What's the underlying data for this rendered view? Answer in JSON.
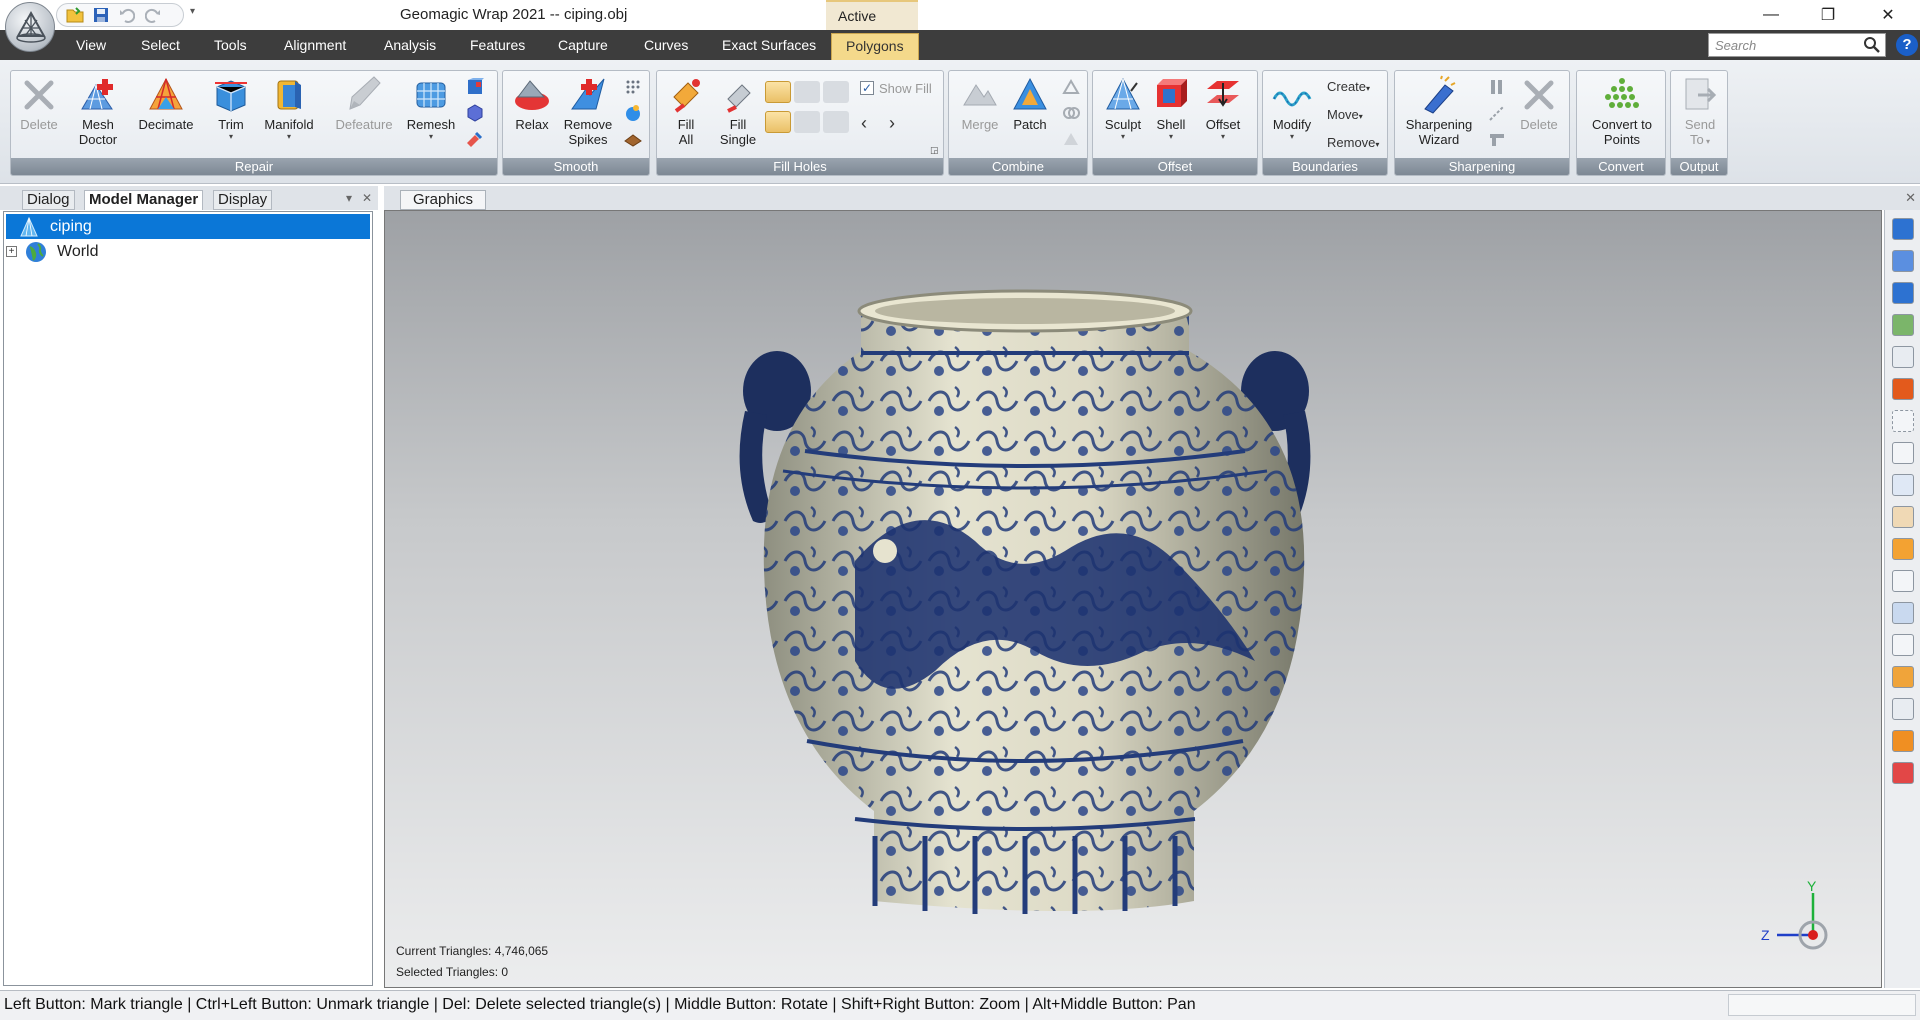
{
  "window": {
    "title": "Geomagic Wrap 2021 -- ciping.obj",
    "context_tab": "Active",
    "controls": {
      "minimize": "—",
      "restore": "❐",
      "close": "✕"
    }
  },
  "quick_access": {
    "dropdown": "▾"
  },
  "menu": {
    "items": [
      "View",
      "Select",
      "Tools",
      "Alignment",
      "Analysis",
      "Features",
      "Capture",
      "Curves",
      "Exact Surfaces",
      "Polygons"
    ],
    "active": "Polygons"
  },
  "search": {
    "placeholder": "Search"
  },
  "help": {
    "label": "?"
  },
  "ribbon": {
    "groups": {
      "repair": "Repair",
      "smooth": "Smooth",
      "fill_holes": "Fill Holes",
      "combine": "Combine",
      "offset": "Offset",
      "boundaries": "Boundaries",
      "sharpening": "Sharpening",
      "convert": "Convert",
      "output": "Output"
    },
    "buttons": {
      "delete": [
        "Delete",
        ""
      ],
      "mesh_doctor": [
        "Mesh",
        "Doctor"
      ],
      "decimate": [
        "Decimate",
        ""
      ],
      "trim": [
        "Trim",
        ""
      ],
      "manifold": [
        "Manifold",
        ""
      ],
      "defeature": [
        "Defeature",
        ""
      ],
      "remesh": [
        "Remesh",
        ""
      ],
      "relax": [
        "Relax",
        ""
      ],
      "remove_spikes": [
        "Remove",
        "Spikes"
      ],
      "fill_all": [
        "Fill",
        "All"
      ],
      "fill_single": [
        "Fill",
        "Single"
      ],
      "show_fill": "Show Fill",
      "merge": [
        "Merge",
        ""
      ],
      "patch": [
        "Patch",
        ""
      ],
      "sculpt": [
        "Sculpt",
        ""
      ],
      "shell": [
        "Shell",
        ""
      ],
      "offset": [
        "Offset",
        ""
      ],
      "modify": [
        "Modify",
        ""
      ],
      "create": "Create",
      "move": "Move",
      "remove": "Remove",
      "sharpening_wizard": [
        "Sharpening",
        "Wizard"
      ],
      "sharpening_delete": [
        "Delete",
        ""
      ],
      "convert_to_points": [
        "Convert to",
        "Points"
      ],
      "send_to": [
        "Send",
        "To"
      ]
    }
  },
  "left_panel": {
    "tabs": [
      "Dialog",
      "Model Manager",
      "Display"
    ],
    "active_tab": "Model Manager",
    "tree": [
      {
        "label": "ciping",
        "selected": true
      },
      {
        "label": "World",
        "selected": false,
        "expander": "+"
      }
    ]
  },
  "graphics": {
    "tab": "Graphics",
    "stats": {
      "current_triangles": "Current Triangles: 4,746,065",
      "selected_triangles": "Selected Triangles: 0"
    },
    "axes": {
      "y": "Y",
      "z": "Z"
    }
  },
  "status_bar": {
    "text": "Left Button: Mark triangle | Ctrl+Left Button: Unmark triangle | Del: Delete selected triangle(s) | Middle Button: Rotate | Shift+Right Button: Zoom | Alt+Middle Button: Pan"
  },
  "colors": {
    "menu_bg": "#3d3d3d",
    "active_menu": "#f4d98b",
    "selection": "#0b77d7",
    "group_label": "#7d8894",
    "porcelain_blue": "#233c7a"
  }
}
